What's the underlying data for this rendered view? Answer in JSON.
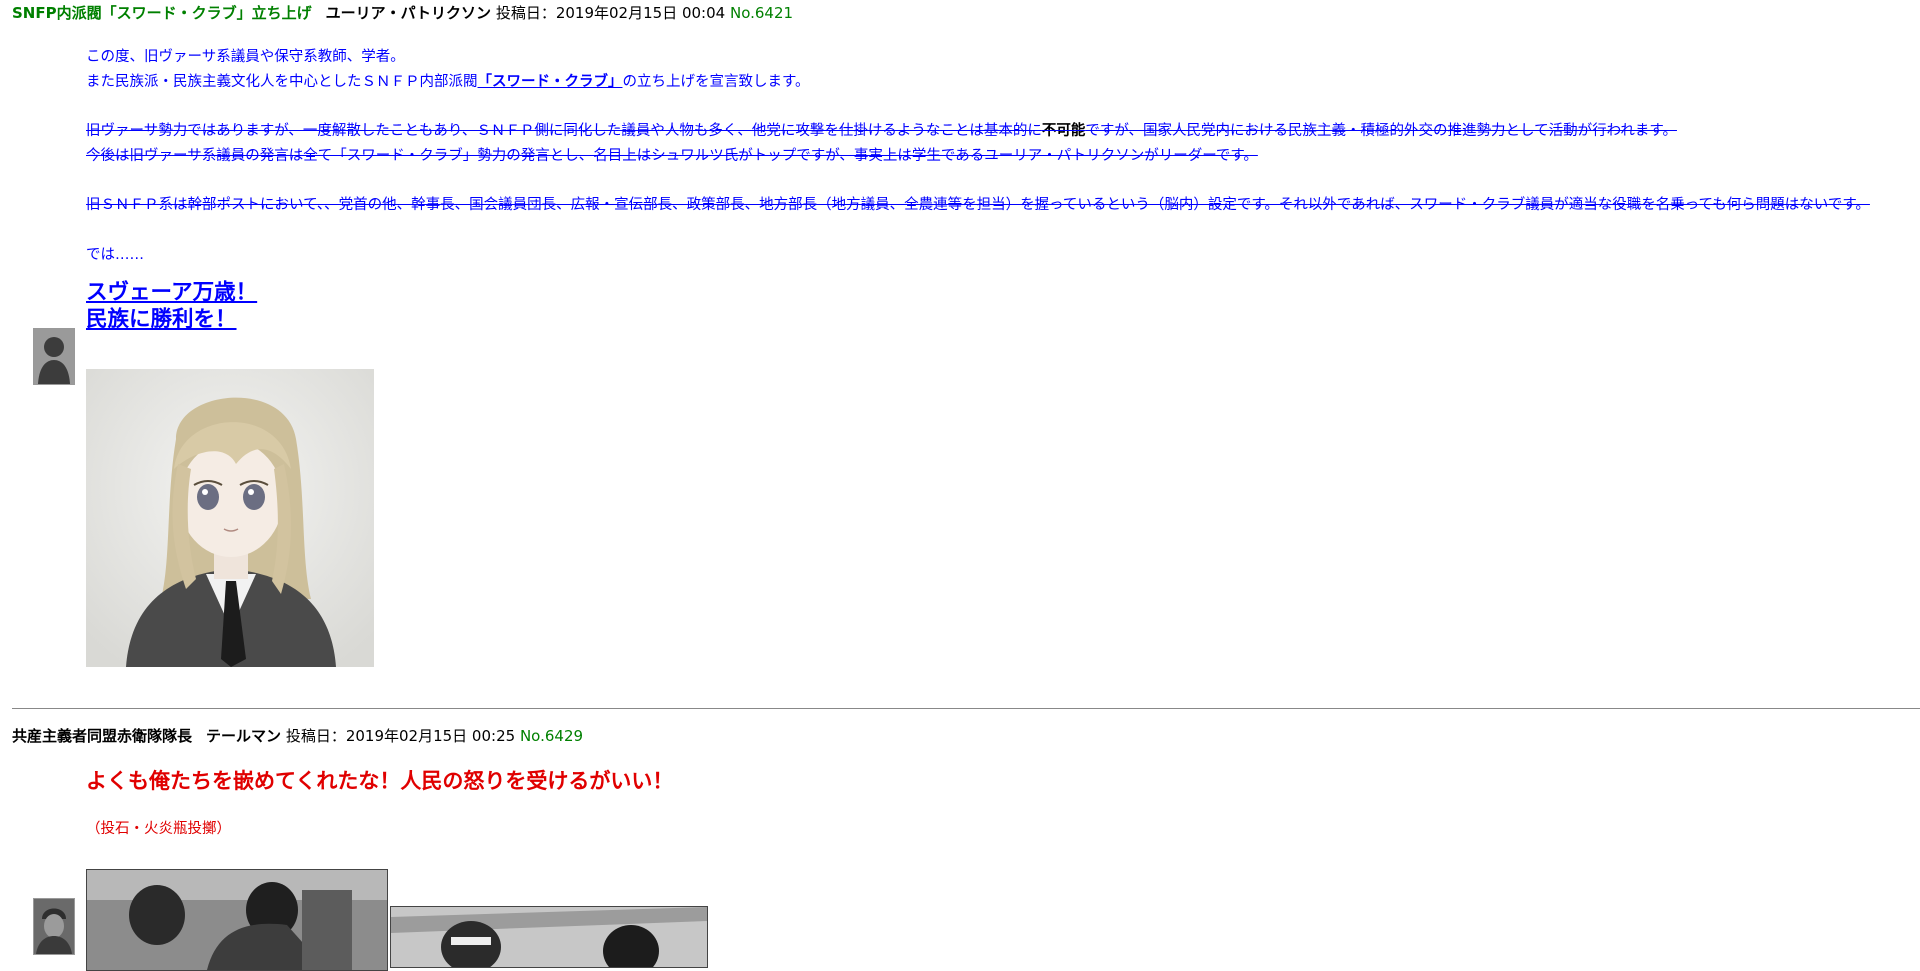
{
  "post1": {
    "title": "SNFP内派閥「スワード・クラブ」立ち上げ",
    "author": "ユーリア・パトリクソン",
    "date": "投稿日：2019年02月15日 00:04",
    "number": "No.6421",
    "line1": "この度、旧ヴァーサ系議員や保守系教師、学者。",
    "line2_pre": "また民族派・民族主義文化人を中心としたＳＮＦＰ内部派閥",
    "line2_link": "「スワード・クラブ」",
    "line2_post": "の立ち上げを宣言致します。",
    "strike1_pre": "旧ヴァーサ勢力ではありますが、一度解散したこともあり、ＳＮＦＰ側に同化した議員や人物も多く、他党に攻撃を仕掛けるようなことは基本的に",
    "strike1_bold": "不可能",
    "strike1_post": "ですが、国家人民党内における民族主義・積極的外交の推進勢力として活動が行われます。",
    "strike2": "今後は旧ヴァーサ系議員の発言は全て「スワード・クラブ」勢力の発言とし、名目上はシュワルツ氏がトップですが、事実上は学生であるユーリア・パトリクソンがリーダーです。",
    "strike3": "旧ＳＮＦＰ系は幹部ポストにおいて、、党首の他、幹事長、国会議員団長、広報・宣伝部長、政策部長、地方部長（地方議員、全農連等を担当）を握っているという（脳内）設定です。それ以外であれば、スワード・クラブ議員が適当な役職を名乗っても何ら問題はないです。",
    "closing": "では……",
    "slogan1": "スヴェーア万歳！",
    "slogan2": "民族に勝利を！"
  },
  "post2": {
    "title": "共産主義者同盟赤衛隊隊長",
    "author": "テールマン",
    "date": "投稿日：2019年02月15日 00:25",
    "number": "No.6429",
    "headline": "よくも俺たちを嵌めてくれたな！人民の怒りを受けるがいい！",
    "note": "（投石・火炎瓶投擲）"
  },
  "colors": {
    "green": "#008000",
    "blue": "#0000ff",
    "red": "#e00000"
  }
}
